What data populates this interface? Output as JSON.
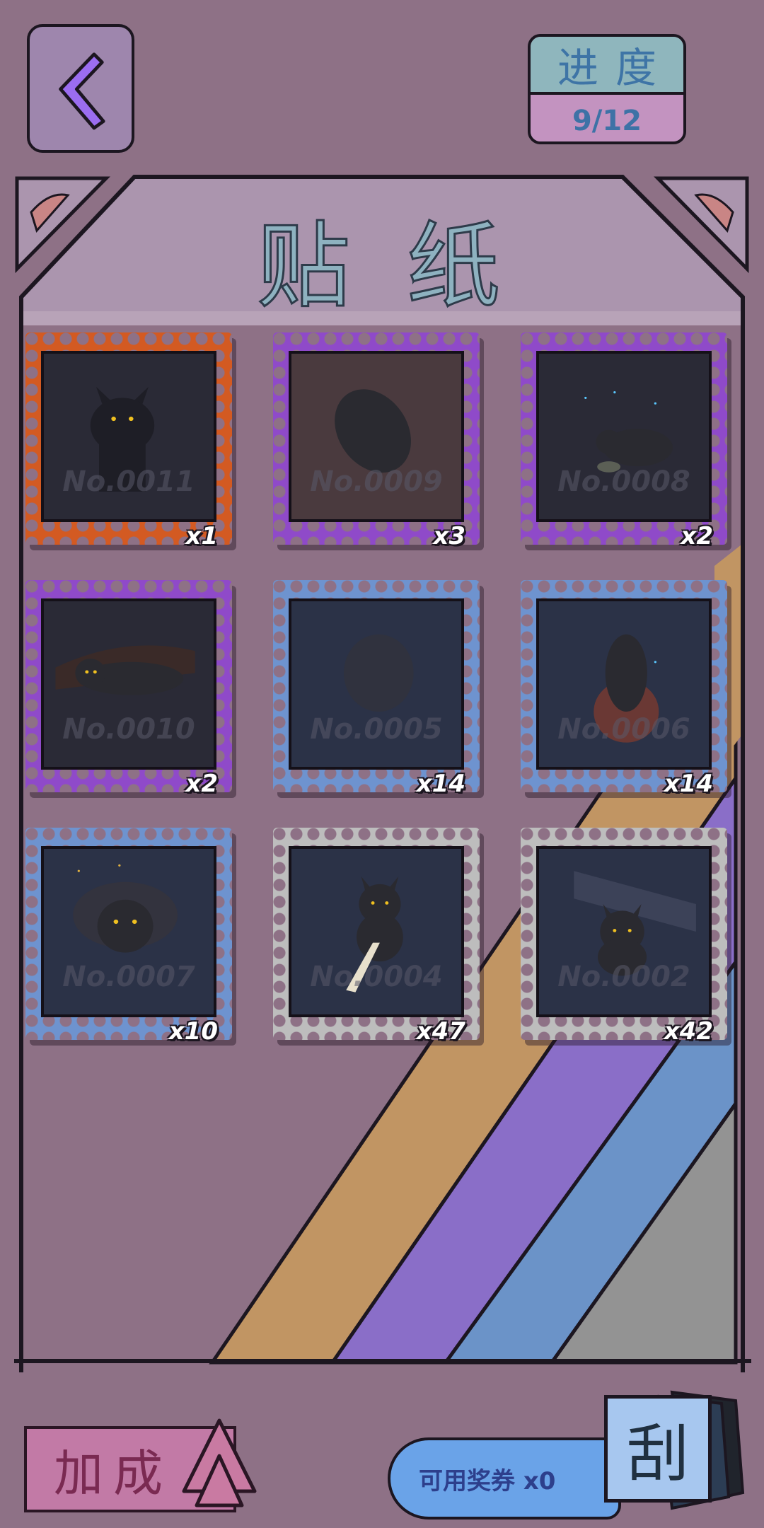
{
  "header": {
    "back_label": "",
    "progress_label": "进度",
    "progress_value": "9/12"
  },
  "panel": {
    "title": "贴纸"
  },
  "stickers": [
    {
      "id_text": "No.0011",
      "count": "x1",
      "border": "#d35a22",
      "scene": "cat-standing"
    },
    {
      "id_text": "No.0009",
      "count": "x3",
      "border": "#8f4ac9",
      "scene": "cat-curled"
    },
    {
      "id_text": "No.0008",
      "count": "x2",
      "border": "#8f4ac9",
      "scene": "cat-eating-rain"
    },
    {
      "id_text": "No.0010",
      "count": "x2",
      "border": "#8f4ac9",
      "scene": "cat-lying"
    },
    {
      "id_text": "No.0005",
      "count": "x14",
      "border": "#6e93cf",
      "scene": "cat-sleeping"
    },
    {
      "id_text": "No.0006",
      "count": "x14",
      "border": "#6e93cf",
      "scene": "cat-ball"
    },
    {
      "id_text": "No.0007",
      "count": "x10",
      "border": "#6e93cf",
      "scene": "cat-blanket"
    },
    {
      "id_text": "No.0004",
      "count": "x47",
      "border": "#bdbdbd",
      "scene": "cat-hand"
    },
    {
      "id_text": "No.0002",
      "count": "x42",
      "border": "#bdbdbd",
      "scene": "cat-sitting"
    }
  ],
  "footer": {
    "boost_label": "加成",
    "coupon_label": "可用奖券 x0",
    "scratch_label": "刮"
  },
  "colors": {
    "background": "#8e7186",
    "stripe_orange": "#c19563",
    "stripe_purple": "#8a6ec8",
    "stripe_blue": "#6b93c8",
    "stripe_gray": "#939393"
  }
}
